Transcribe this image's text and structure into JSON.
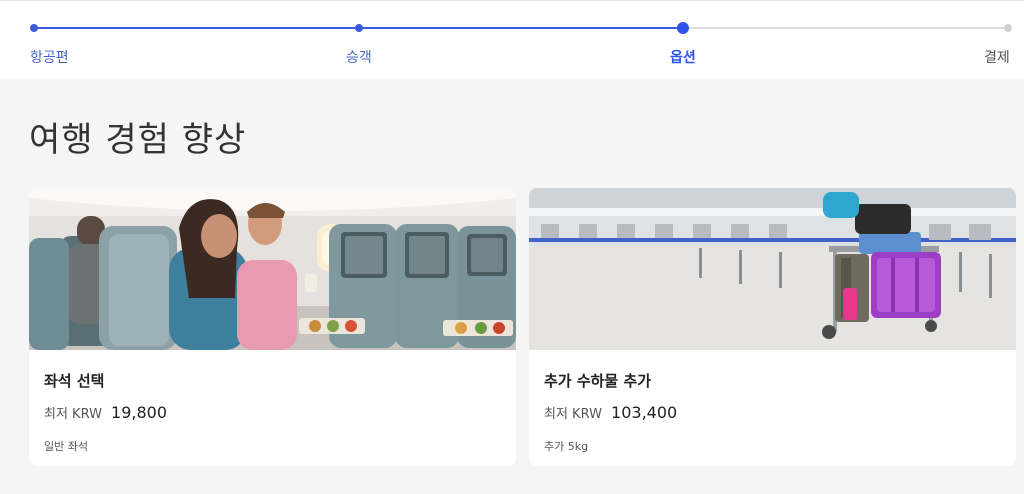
{
  "stepper": {
    "steps": [
      {
        "label": "항공편",
        "state": "done"
      },
      {
        "label": "승객",
        "state": "done"
      },
      {
        "label": "옵션",
        "state": "current"
      },
      {
        "label": "결제",
        "state": "todo"
      }
    ],
    "colors": {
      "done": "#3b5bdb",
      "current": "#2f54eb",
      "todo": "#d0d0d0"
    }
  },
  "page": {
    "title": "여행 경험 향상"
  },
  "cards": [
    {
      "title": "좌석 선택",
      "price_prefix": "최저 KRW",
      "price": "19,800",
      "note": "일반 좌석",
      "image": "airplane-cabin-photo"
    },
    {
      "title": "추가 수하물 추가",
      "price_prefix": "최저 KRW",
      "price": "103,400",
      "note": "추가 5kg",
      "image": "airport-luggage-cart-photo"
    }
  ]
}
